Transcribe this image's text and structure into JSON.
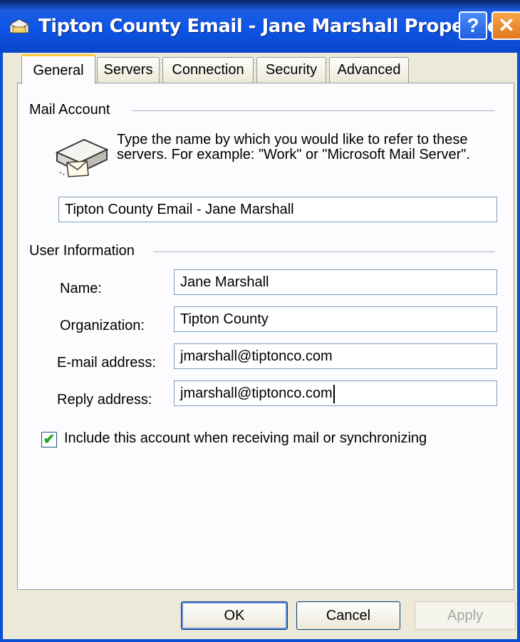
{
  "window": {
    "title": "Tipton County Email - Jane Marshall Properties",
    "help_glyph": "?",
    "close_glyph": "✕"
  },
  "tabs": [
    {
      "label": "General"
    },
    {
      "label": "Servers"
    },
    {
      "label": "Connection"
    },
    {
      "label": "Security"
    },
    {
      "label": "Advanced"
    }
  ],
  "mail_account": {
    "group_label": "Mail Account",
    "description": "Type the name by which you would like to refer to these servers.  For example: \"Work\" or \"Microsoft Mail Server\".",
    "account_name": "Tipton County Email - Jane Marshall"
  },
  "user_info": {
    "group_label": "User Information",
    "name_label": "Name:",
    "name_value": "Jane Marshall",
    "org_label": "Organization:",
    "org_value": "Tipton County",
    "email_label": "E-mail address:",
    "email_value": "jmarshall@tiptonco.com",
    "reply_label": "Reply address:",
    "reply_value": "jmarshall@tiptonco.com"
  },
  "include_account": {
    "label": "Include this account when receiving mail or synchronizing",
    "checked": true
  },
  "buttons": {
    "ok": "OK",
    "cancel": "Cancel",
    "apply": "Apply"
  },
  "icons": {
    "title": "mail-account-icon",
    "account": "mail-server-icon"
  }
}
